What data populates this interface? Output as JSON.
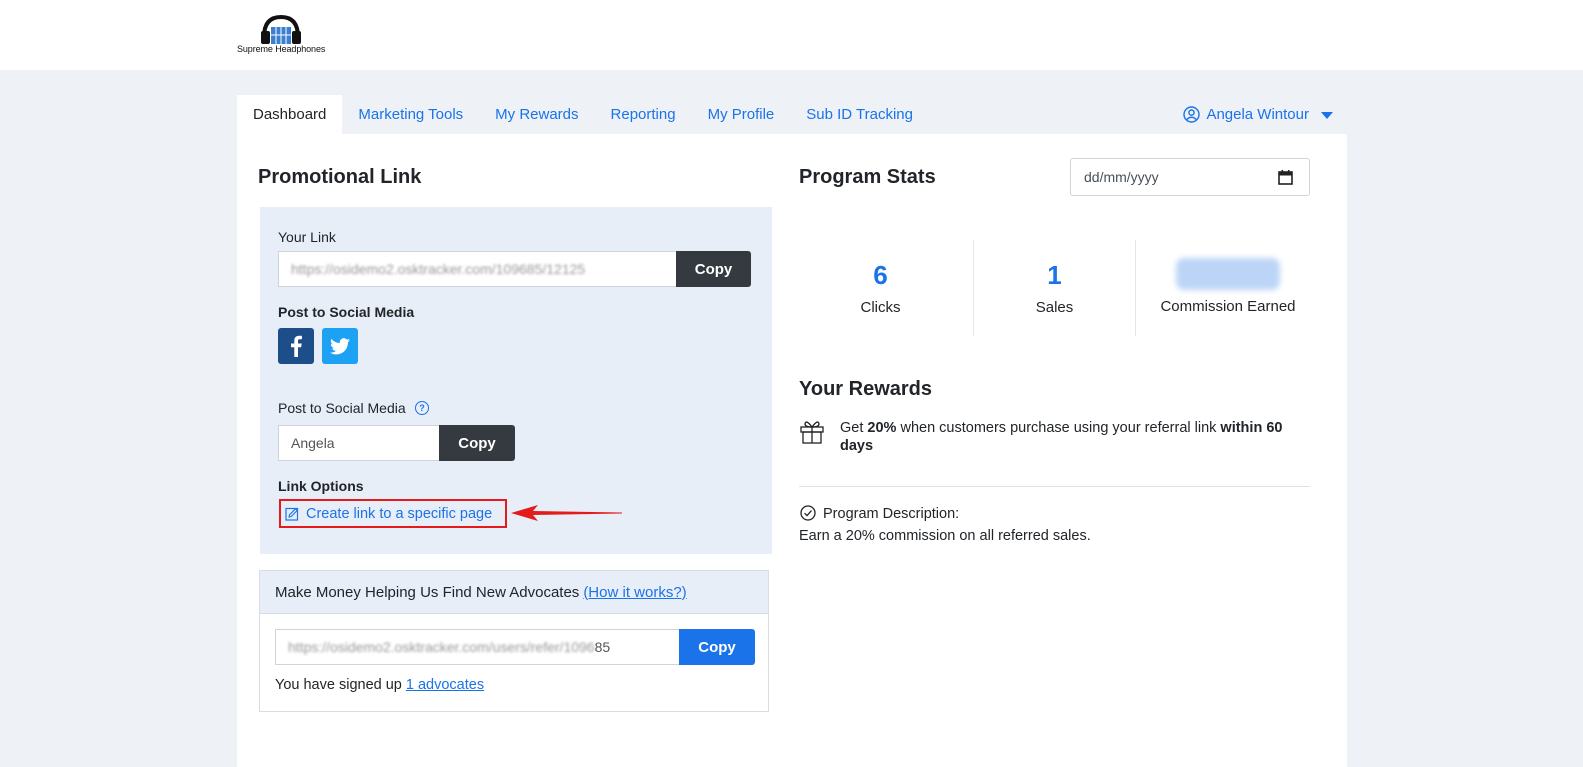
{
  "header": {
    "logo_text": "Supreme Headphones",
    "logo_icon": "headphones-logo"
  },
  "nav": {
    "tabs": [
      {
        "label": "Dashboard",
        "active": true
      },
      {
        "label": "Marketing Tools",
        "active": false
      },
      {
        "label": "My Rewards",
        "active": false
      },
      {
        "label": "Reporting",
        "active": false
      },
      {
        "label": "My Profile",
        "active": false
      },
      {
        "label": "Sub ID Tracking",
        "active": false
      }
    ],
    "user_name": "Angela Wintour",
    "user_icon": "user-circle-icon"
  },
  "promotional": {
    "title": "Promotional Link",
    "your_link_label": "Your Link",
    "your_link_value": "https://osidemo2.osktracker.com/109685/12125",
    "copy_label": "Copy",
    "social_title": "Post to Social Media",
    "social_buttons": [
      {
        "name": "facebook",
        "icon": "facebook-icon",
        "color": "#1d4e89"
      },
      {
        "name": "twitter",
        "icon": "twitter-icon",
        "color": "#1da1f2"
      }
    ],
    "coupon_label": "Post to Social Media",
    "coupon_value": "Angela",
    "coupon_copy_label": "Copy",
    "link_options_title": "Link Options",
    "create_link_label": "Create link to a specific page",
    "create_link_icon": "edit-icon",
    "highlight_color": "#e31b1b"
  },
  "advocates": {
    "heading": "Make Money Helping Us Find New Advocates",
    "how_link": "(How it works?)",
    "refer_link_value": "https://osidemo2.osktracker.com/users/refer/1096",
    "refer_link_suffix": "85",
    "copy_label": "Copy",
    "signed_up_text": "You have signed up",
    "signed_up_link": "1 advocates"
  },
  "stats": {
    "title": "Program Stats",
    "date_placeholder": "dd/mm/yyyy",
    "items": [
      {
        "value": "6",
        "caption": "Clicks"
      },
      {
        "value": "1",
        "caption": "Sales"
      },
      {
        "value": "",
        "caption": "Commission Earned"
      }
    ]
  },
  "rewards": {
    "title": "Your Rewards",
    "gift_icon": "gift-icon",
    "text_pre": "Get ",
    "text_bold1": "20%",
    "text_mid": " when customers purchase using your referral link ",
    "text_bold2": "within 60 days",
    "desc_icon": "check-circle-icon",
    "desc_label": "Program Description:",
    "desc_text": "Earn a 20% commission on all referred sales."
  }
}
